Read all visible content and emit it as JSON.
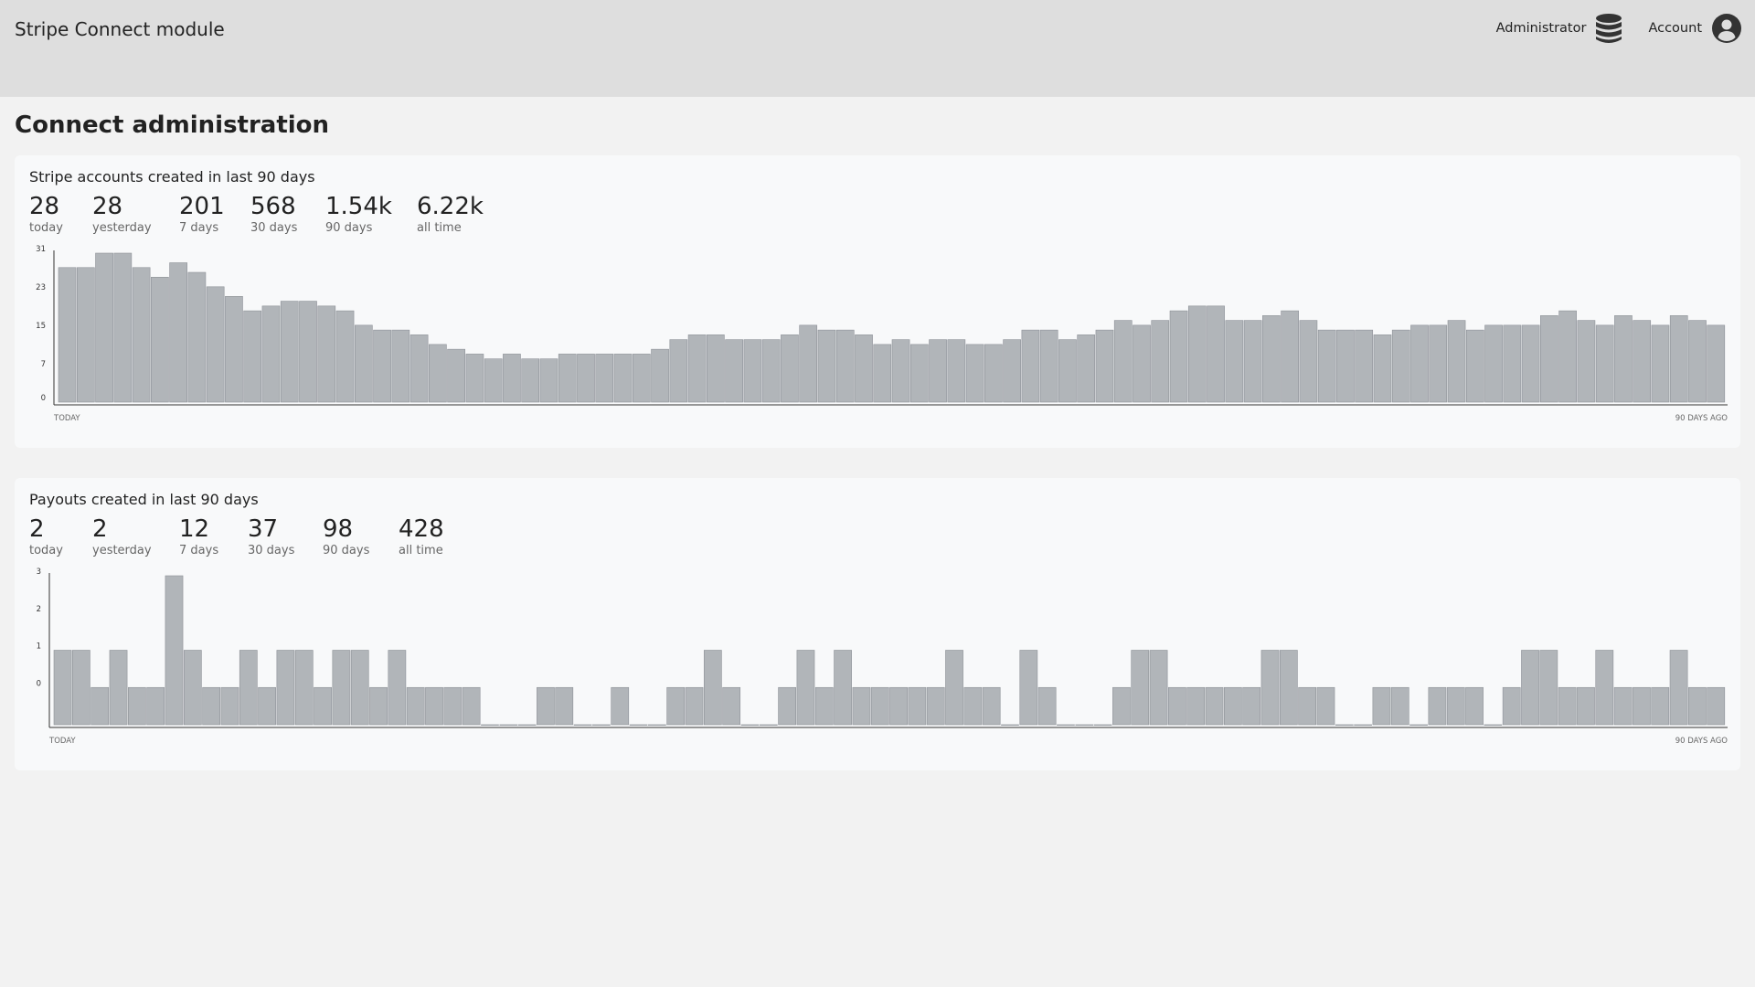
{
  "app": {
    "title": "Stripe Connect module",
    "administrator_label": "Administrator",
    "account_label": "Account",
    "icons": {
      "administrator": "database-icon",
      "account": "user-circle-icon"
    }
  },
  "page": {
    "title": "Connect administration"
  },
  "colors": {
    "bar_fill": "#b1b5b9",
    "bar_stroke": "#8d9197",
    "axis": "#333333",
    "topbar": "#dedede",
    "card": "#f8f9fa"
  },
  "cards": [
    {
      "title": "Stripe accounts created in last 90 days",
      "stats": [
        {
          "value": "28",
          "label": "today"
        },
        {
          "value": "28",
          "label": "yesterday"
        },
        {
          "value": "201",
          "label": "7 days"
        },
        {
          "value": "568",
          "label": "30 days"
        },
        {
          "value": "1.54k",
          "label": "90 days"
        },
        {
          "value": "6.22k",
          "label": "all time"
        }
      ]
    },
    {
      "title": "Payouts created in last 90 days",
      "stats": [
        {
          "value": "2",
          "label": "today"
        },
        {
          "value": "2",
          "label": "yesterday"
        },
        {
          "value": "12",
          "label": "7 days"
        },
        {
          "value": "37",
          "label": "30 days"
        },
        {
          "value": "98",
          "label": "90 days"
        },
        {
          "value": "428",
          "label": "all time"
        }
      ]
    }
  ],
  "chart_data": [
    {
      "type": "bar",
      "x_start_label": "TODAY",
      "x_end_label": "90 DAYS AGO",
      "yticks": [
        0,
        7,
        15,
        23,
        31
      ],
      "ylim": [
        0,
        31
      ],
      "grid": false,
      "values": [
        28,
        28,
        31,
        31,
        28,
        26,
        29,
        27,
        24,
        22,
        19,
        20,
        21,
        21,
        20,
        19,
        16,
        15,
        15,
        14,
        12,
        11,
        10,
        9,
        10,
        9,
        9,
        10,
        10,
        10,
        10,
        10,
        11,
        13,
        14,
        14,
        13,
        13,
        13,
        14,
        16,
        15,
        15,
        14,
        12,
        13,
        12,
        13,
        13,
        12,
        12,
        13,
        15,
        15,
        13,
        14,
        15,
        17,
        16,
        17,
        19,
        20,
        20,
        17,
        17,
        18,
        19,
        17,
        15,
        15,
        15,
        14,
        15,
        16,
        16,
        17,
        15,
        16,
        16,
        16,
        18,
        19,
        17,
        16,
        18,
        17,
        16,
        18,
        17,
        16
      ]
    },
    {
      "type": "bar",
      "x_start_label": "TODAY",
      "x_end_label": "90 DAYS AGO",
      "yticks": [
        0,
        1,
        2,
        3
      ],
      "ylim": [
        -1,
        3
      ],
      "grid": false,
      "values": [
        1,
        1,
        0,
        1,
        0,
        0,
        3,
        1,
        0,
        0,
        1,
        0,
        1,
        1,
        0,
        1,
        1,
        0,
        1,
        0,
        0,
        0,
        0,
        -1,
        -1,
        -1,
        0,
        0,
        -1,
        -1,
        0,
        -1,
        -1,
        0,
        0,
        1,
        0,
        -1,
        -1,
        0,
        1,
        0,
        1,
        0,
        0,
        0,
        0,
        0,
        1,
        0,
        0,
        -1,
        1,
        0,
        -1,
        -1,
        -1,
        0,
        1,
        1,
        0,
        0,
        0,
        0,
        0,
        1,
        1,
        0,
        0,
        -1,
        -1,
        0,
        0,
        -1,
        0,
        0,
        0,
        -1,
        0,
        1,
        1,
        0,
        0,
        1,
        0,
        0,
        0,
        1,
        0,
        0
      ]
    }
  ]
}
